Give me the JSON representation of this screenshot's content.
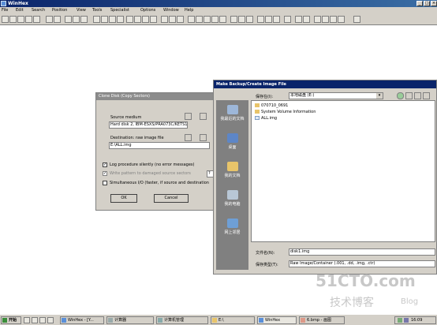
{
  "app": {
    "title": "WinHex"
  },
  "menu": [
    "File",
    "Edit",
    "Search",
    "Position",
    "View",
    "Tools",
    "Specialist",
    "Options",
    "Window",
    "Help"
  ],
  "clone_dialog": {
    "title": "Clone Disk (Copy Sectors)",
    "source_label": "Source medium",
    "source_value": "Hard disk 2, IBM-ESXS/PRA073C/KETS10 N B8",
    "dest_label": "Destination: raw image file",
    "dest_value": "E:\\ALL.img",
    "opt_log": "Log procedure silently (no error messages)",
    "opt_log_checked": true,
    "opt_write": "Write pattern to damaged source sectors",
    "opt_write_checked": true,
    "opt_write_value": "?",
    "opt_simul": "Simultaneous I/O (faster, if source and destination",
    "opt_simul_checked": false,
    "ok_label": "OK",
    "cancel_label": "Cancel"
  },
  "file_dialog": {
    "title": "Make Backup/Create Image File",
    "save_in_label": "保存在(I):",
    "save_in_value": "本地磁盘 (E:)",
    "places": [
      "我最近的文档",
      "桌面",
      "我的文档",
      "我的电脑",
      "网上邻居"
    ],
    "files": [
      "070710_0691",
      "System Volume Information",
      "ALL.img"
    ],
    "filename_label": "文件名(N):",
    "filename_value": "disk1.img",
    "filetype_label": "保存类型(T):",
    "filetype_value": "Raw Image/Container (.001, .dd, .img, .ctr)"
  },
  "taskbar": {
    "start": "开始",
    "items": [
      "WinHex - [Y...",
      "计算器",
      "计算机管理",
      "E:\\",
      "WinHex",
      "6.bmp - 画图"
    ],
    "clock": "16:09"
  },
  "watermark": {
    "site": "51CTO.com",
    "sub": "技术博客",
    "blog": "Blog"
  }
}
